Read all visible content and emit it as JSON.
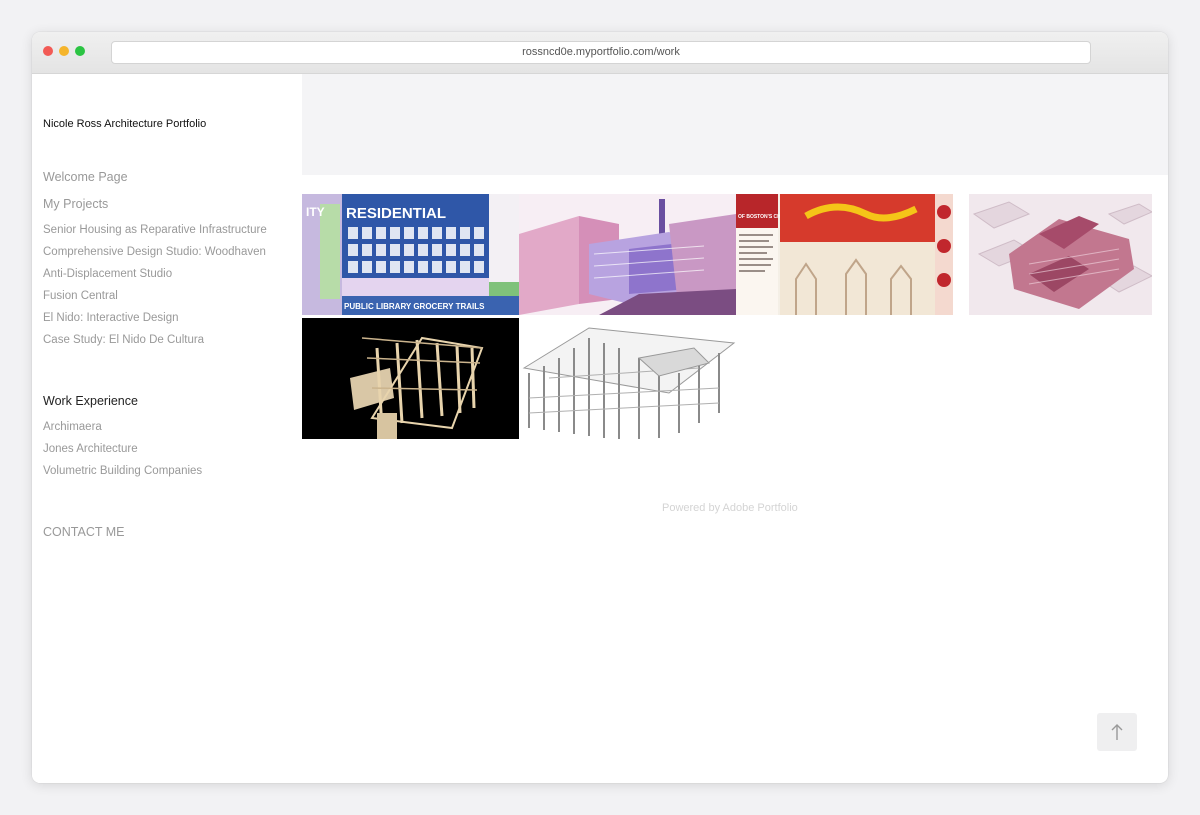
{
  "browser": {
    "url": "rossncd0e.myportfolio.com/work"
  },
  "sidebar": {
    "site_title": "Nicole Ross Architecture Portfolio",
    "welcome_label": "Welcome Page",
    "projects_heading": "My Projects",
    "projects": [
      "Senior Housing as Reparative Infrastructure",
      "Comprehensive Design Studio: Woodhaven",
      "Anti-Displacement Studio",
      "Fusion Central",
      "El Nido: Interactive Design",
      "Case Study: El Nido De Cultura"
    ],
    "work_heading": "Work Experience",
    "work_items": [
      "Archimaera",
      "Jones Architecture",
      "Volumetric Building Companies"
    ],
    "contact_label": "CONTACT ME"
  },
  "gallery": {
    "tiles": [
      {
        "name": "residential-section-tile",
        "text_main": "RESIDENTIAL",
        "text_side": "ITY",
        "text_bottom": "PUBLIC LIBRARY  GROCERY  TRAILS"
      },
      {
        "name": "pink-massing-tile"
      },
      {
        "name": "chinatown-board-tile",
        "title_text": "OF BOSTON'S CHINATOWN:"
      },
      {
        "name": "site-axon-tile"
      },
      {
        "name": "timber-model-tile"
      },
      {
        "name": "structure-frame-tile"
      }
    ]
  },
  "footer": {
    "powered_by": "Powered by Adobe Portfolio"
  },
  "icons": {
    "back_to_top": "arrow-up-icon"
  },
  "colors": {
    "accent_blue": "#3a63b0",
    "pink": "#e2a9c8",
    "red": "#d63a2c"
  }
}
